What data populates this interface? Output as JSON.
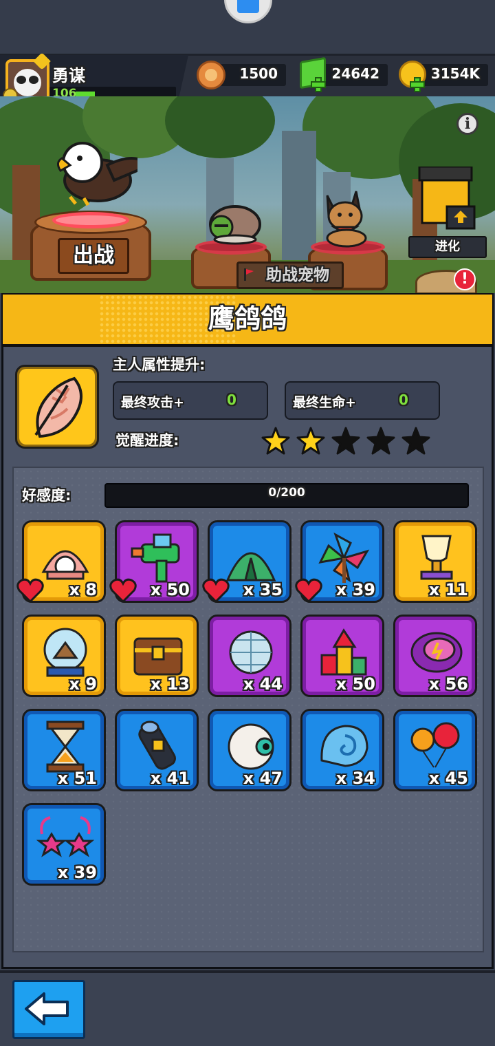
{
  "player": {
    "name": "勇谋",
    "level": "106",
    "exp_fraction": 0.2
  },
  "currencies": [
    {
      "id": "token",
      "value": "1500"
    },
    {
      "id": "gem",
      "value": "24642"
    },
    {
      "id": "gold",
      "value": "3154K"
    }
  ],
  "scene": {
    "battle_button": "出战",
    "assist_pets_label": "助战宠物",
    "evolve_button": "进化"
  },
  "panel": {
    "title": "鹰鸽鸽",
    "attr_title": "主人属性提升:",
    "stats": [
      {
        "label": "最终攻击+",
        "value": "0"
      },
      {
        "label": "最终生命+",
        "value": "0"
      }
    ],
    "awaken_label": "觉醒进度:",
    "awaken_stars_filled": 2,
    "awaken_stars_total": 5,
    "favor_label": "好感度:",
    "favor_value": "0/200"
  },
  "items": [
    {
      "name": "pearl-shell",
      "rarity": "gold",
      "count": "x 8",
      "favorite": true
    },
    {
      "name": "water-gun",
      "rarity": "purple",
      "count": "x 50",
      "favorite": true
    },
    {
      "name": "green-tent",
      "rarity": "blue",
      "count": "x 35",
      "favorite": true
    },
    {
      "name": "pinwheel",
      "rarity": "blue",
      "count": "x 39",
      "favorite": true
    },
    {
      "name": "trophy-cup",
      "rarity": "gold",
      "count": "x 11",
      "favorite": false
    },
    {
      "name": "snow-globe",
      "rarity": "gold",
      "count": "x 9",
      "favorite": false
    },
    {
      "name": "treasure-chest",
      "rarity": "gold",
      "count": "x 13",
      "favorite": false
    },
    {
      "name": "disco-ball",
      "rarity": "purple",
      "count": "x 44",
      "favorite": false
    },
    {
      "name": "toy-blocks",
      "rarity": "purple",
      "count": "x 50",
      "favorite": false
    },
    {
      "name": "frisbee",
      "rarity": "purple",
      "count": "x 56",
      "favorite": false
    },
    {
      "name": "hourglass",
      "rarity": "blue",
      "count": "x 51",
      "favorite": false
    },
    {
      "name": "flashlight",
      "rarity": "blue",
      "count": "x 41",
      "favorite": false
    },
    {
      "name": "eyeball-toy",
      "rarity": "blue",
      "count": "x 47",
      "favorite": false
    },
    {
      "name": "seashell",
      "rarity": "blue",
      "count": "x 34",
      "favorite": false
    },
    {
      "name": "balloons",
      "rarity": "blue",
      "count": "x 45",
      "favorite": false
    },
    {
      "name": "star-glasses",
      "rarity": "blue",
      "count": "x 39",
      "favorite": false
    }
  ],
  "colors": {
    "gold": "#ffc21e",
    "purple": "#b13bd9",
    "blue": "#1d8be8",
    "accent": "#f6b716"
  }
}
